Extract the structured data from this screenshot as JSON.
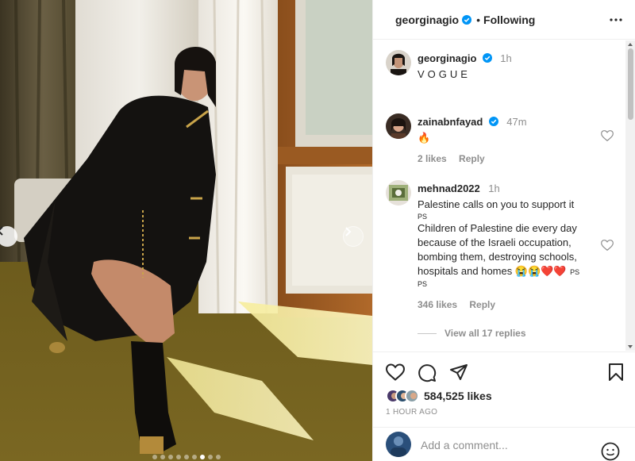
{
  "post": {
    "author": "georginagio",
    "follow_status": "Following",
    "separator": "•",
    "images_count": 9,
    "active_image_index": 6
  },
  "caption": {
    "username": "georginagio",
    "time": "1h",
    "text": "VOGUE"
  },
  "comments": [
    {
      "username": "zainabnfayad",
      "verified": true,
      "time": "47m",
      "text": "🔥",
      "likes": "2 likes",
      "reply": "Reply"
    },
    {
      "username": "mehnad2022",
      "verified": false,
      "time": "1h",
      "lines": [
        "Palestine calls on you to support it",
        "PS",
        "Children of Palestine die every day",
        "because of the Israeli occupation,",
        "bombing them, destroying schools,",
        "hospitals and homes 😭😭❤️❤️",
        "PS",
        "PS"
      ],
      "likes": "346 likes",
      "reply": "Reply",
      "view_replies": "View all 17 replies"
    }
  ],
  "stats": {
    "likes": "584,525 likes",
    "time_ago": "1 HOUR AGO"
  },
  "composer": {
    "placeholder": "Add a comment..."
  },
  "icons": {
    "verified": "verified-badge-icon",
    "more": "more-horizontal-icon",
    "heart": "heart-icon",
    "comment": "comment-icon",
    "share": "send-icon",
    "save": "bookmark-icon",
    "emoji": "smiley-icon",
    "prev": "chevron-left-icon",
    "next": "chevron-right-icon"
  },
  "colors": {
    "verified_blue": "#0095f6",
    "text": "#262626",
    "muted": "#8e8e8e",
    "border": "#efefef"
  }
}
